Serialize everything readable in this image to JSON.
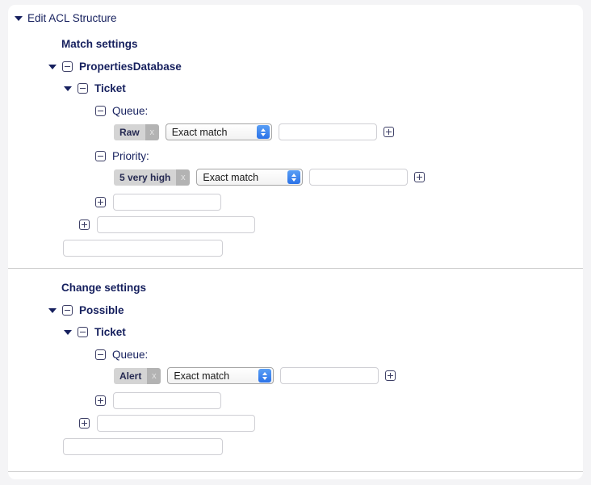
{
  "header": {
    "label": "Edit ACL Structure",
    "toggle_icon": "triangle-down-icon"
  },
  "colors": {
    "text": "#16205e",
    "chip_bg": "#d4d4d4",
    "chip_x_bg": "#b3b3b3",
    "select_arrow": "#2b72e8",
    "panel_bg": "#ffffff",
    "page_bg": "#f4f4f6",
    "divider": "#cccccc"
  },
  "sections": [
    {
      "title": "Match settings",
      "root": {
        "label": "PropertiesDatabase",
        "collapse_icon": "minus-box-icon",
        "toggle_icon": "triangle-down-icon"
      },
      "child": {
        "label": "Ticket",
        "collapse_icon": "minus-box-icon",
        "toggle_icon": "triangle-down-icon"
      },
      "fields": [
        {
          "label": "Queue:",
          "collapse_icon": "minus-box-icon",
          "chip": {
            "value": "Raw",
            "remove_label": "x"
          },
          "match": {
            "value": "Exact match"
          },
          "text_value": "",
          "text_placeholder": "",
          "add_icon": "plus-box-icon"
        },
        {
          "label": "Priority:",
          "collapse_icon": "minus-box-icon",
          "chip": {
            "value": "5 very high",
            "remove_label": "x"
          },
          "match": {
            "value": "Exact match"
          },
          "text_value": "",
          "text_placeholder": "",
          "add_icon": "plus-box-icon"
        }
      ],
      "add_rows": [
        {
          "add_icon": "plus-box-icon",
          "value": "",
          "placeholder": ""
        },
        {
          "add_icon": "plus-box-icon",
          "value": "",
          "placeholder": ""
        },
        {
          "add_icon": null,
          "value": "",
          "placeholder": ""
        }
      ]
    },
    {
      "title": "Change settings",
      "root": {
        "label": "Possible",
        "collapse_icon": "minus-box-icon",
        "toggle_icon": "triangle-down-icon"
      },
      "child": {
        "label": "Ticket",
        "collapse_icon": "minus-box-icon",
        "toggle_icon": "triangle-down-icon"
      },
      "fields": [
        {
          "label": "Queue:",
          "collapse_icon": "minus-box-icon",
          "chip": {
            "value": "Alert",
            "remove_label": "x"
          },
          "match": {
            "value": "Exact match"
          },
          "text_value": "",
          "text_placeholder": "",
          "add_icon": "plus-box-icon"
        }
      ],
      "add_rows": [
        {
          "add_icon": "plus-box-icon",
          "value": "",
          "placeholder": ""
        },
        {
          "add_icon": "plus-box-icon",
          "value": "",
          "placeholder": ""
        },
        {
          "add_icon": null,
          "value": "",
          "placeholder": ""
        }
      ]
    }
  ]
}
